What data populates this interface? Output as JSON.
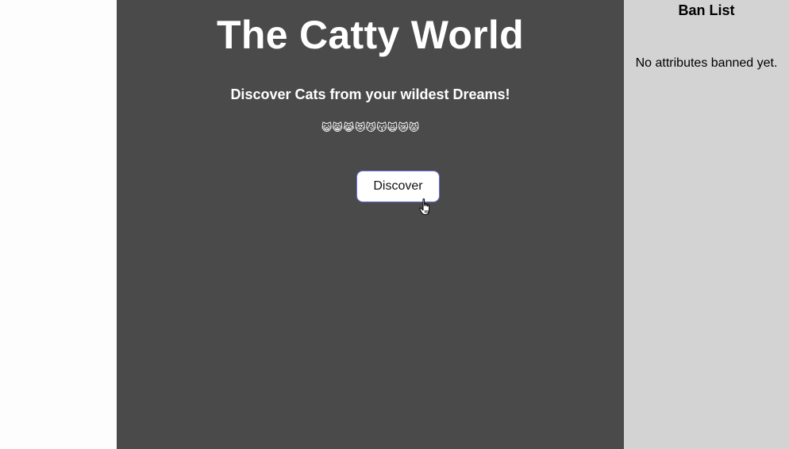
{
  "main": {
    "title": "The Catty World",
    "subtitle": "Discover Cats from your wildest Dreams!",
    "emojis": "😺😸😹😻😼😽🙀😿😾",
    "discover_label": "Discover"
  },
  "ban_list": {
    "title": "Ban List",
    "empty_message": "No attributes banned yet."
  },
  "colors": {
    "main_background": "#4a4a4a",
    "sidebar_background": "#d3d3d3",
    "button_border": "#6b6fe0"
  }
}
